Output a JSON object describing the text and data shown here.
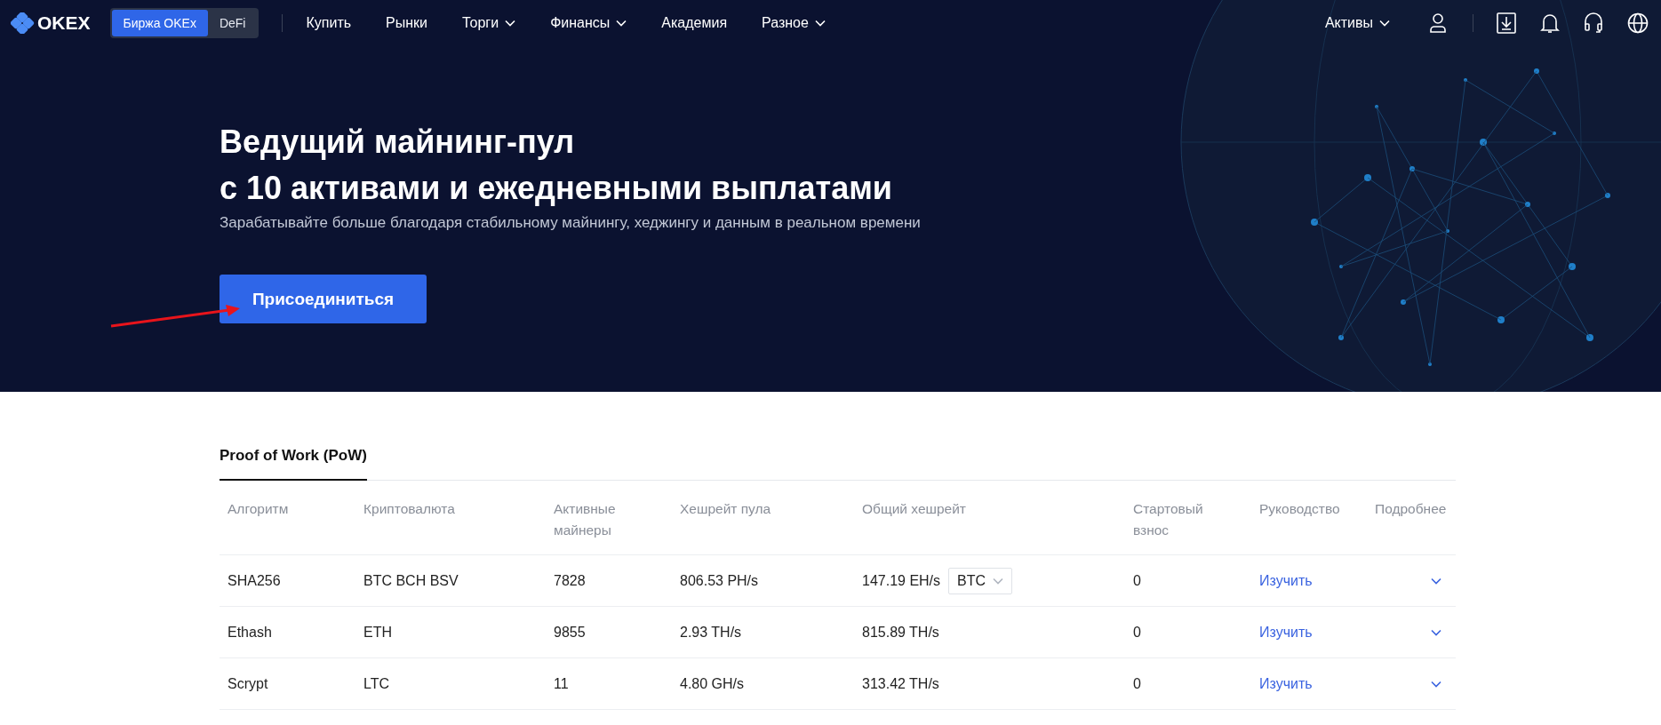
{
  "header": {
    "logo": "OKEX",
    "switch": [
      {
        "label": "Биржа OKEx",
        "selected": true
      },
      {
        "label": "DeFi",
        "selected": false
      }
    ],
    "menu": [
      {
        "label": "Купить",
        "dropdown": false
      },
      {
        "label": "Рынки",
        "dropdown": false
      },
      {
        "label": "Торги",
        "dropdown": true
      },
      {
        "label": "Финансы",
        "dropdown": true
      },
      {
        "label": "Академия",
        "dropdown": false
      },
      {
        "label": "Разное",
        "dropdown": true
      }
    ],
    "assets": {
      "label": "Активы",
      "dropdown": true
    }
  },
  "hero": {
    "title_lines": [
      "Ведущий майнинг-пул",
      "с 10 активами и ежедневными выплатами"
    ],
    "subtitle": "Зарабатывайте больше благодаря стабильному майнингу, хеджингу и данным в реальном времени",
    "button": "Присоединиться"
  },
  "tabs": [
    {
      "label": "Proof of Work (PoW)",
      "selected": true
    }
  ],
  "table": {
    "columns": [
      "Алгоритм",
      "Криптовалюта",
      "Активные майнеры",
      "Хешрейт пула",
      "Общий хешрейт",
      "Стартовый взнос",
      "Руководство",
      "Подробнее"
    ],
    "rows": [
      {
        "algorithm": "SHA256",
        "coins": "BTC BCH BSV",
        "miners": "7828",
        "pool_hashrate": "806.53 PH/s",
        "total_hashrate": "147.19 EH/s",
        "coin_select": "BTC",
        "fee": "0",
        "guide": "Изучить"
      },
      {
        "algorithm": "Ethash",
        "coins": "ETH",
        "miners": "9855",
        "pool_hashrate": "2.93 TH/s",
        "total_hashrate": "815.89 TH/s",
        "fee": "0",
        "guide": "Изучить"
      },
      {
        "algorithm": "Scrypt",
        "coins": "LTC",
        "miners": "11",
        "pool_hashrate": "4.80 GH/s",
        "total_hashrate": "313.42 TH/s",
        "fee": "0",
        "guide": "Изучить"
      }
    ]
  }
}
